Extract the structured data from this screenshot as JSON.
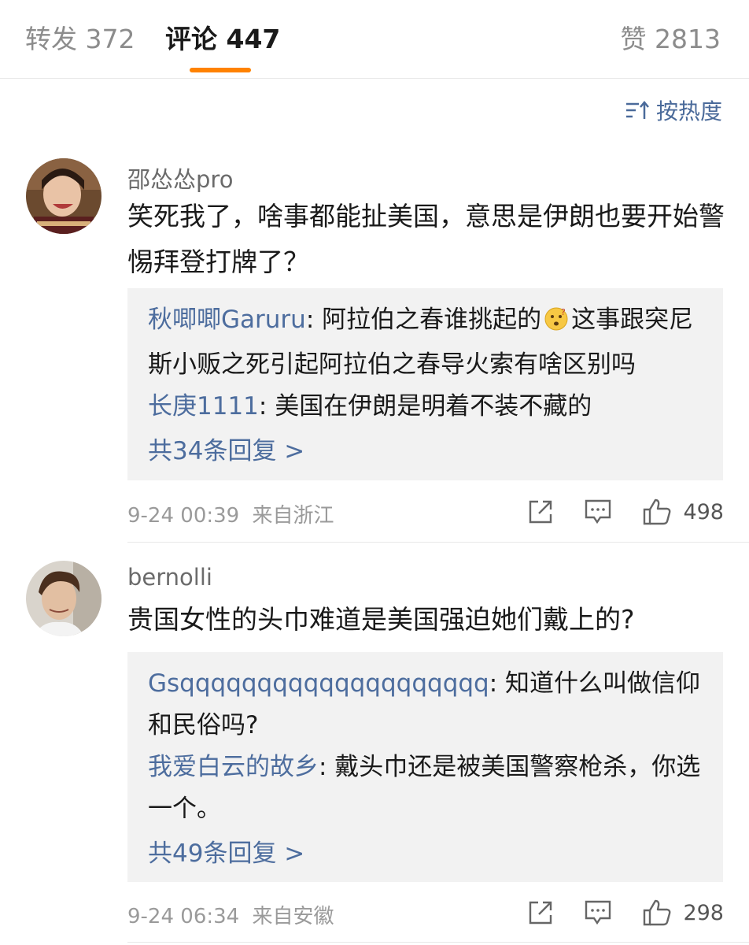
{
  "tabs": {
    "repost": "转发 372",
    "comments": "评论 447",
    "likes": "赞 2813"
  },
  "sort": {
    "label": "按热度",
    "icon": "sort-icon"
  },
  "comments": [
    {
      "username": "邵怂怂pro",
      "content": "笑死我了，啥事都能扯美国，意思是伊朗也要开始警惕拜登打牌了？",
      "replies": [
        {
          "author": "秋唧唧Garuru",
          "text_before_emoji": "阿拉伯之春谁挑起的",
          "emoji": "thinking-face-emoji",
          "text_after_emoji": "这事跟突尼斯小贩之死引起阿拉伯之春导火索有啥区别吗"
        },
        {
          "author": "长庚1111",
          "text": "美国在伊朗是明着不装不藏的"
        }
      ],
      "reply_count_label": "共34条回复 >",
      "timestamp": "9-24 00:39",
      "location": "来自浙江",
      "likes": "498"
    },
    {
      "username": "bernolli",
      "content": "贵国女性的头巾难道是美国强迫她们戴上的?",
      "replies": [
        {
          "author": "Gsqqqqqqqqqqqqqqqqqqqq",
          "text": "知道什么叫做信仰和民俗吗?"
        },
        {
          "author": "我爱白云的故乡",
          "text": "戴头巾还是被美国警察枪杀，你选一个。"
        }
      ],
      "reply_count_label": "共49条回复 >",
      "timestamp": "9-24 06:34",
      "location": "来自安徽",
      "likes": "298"
    }
  ],
  "colors": {
    "accent": "#ff8200",
    "link": "#4d6d9e"
  }
}
